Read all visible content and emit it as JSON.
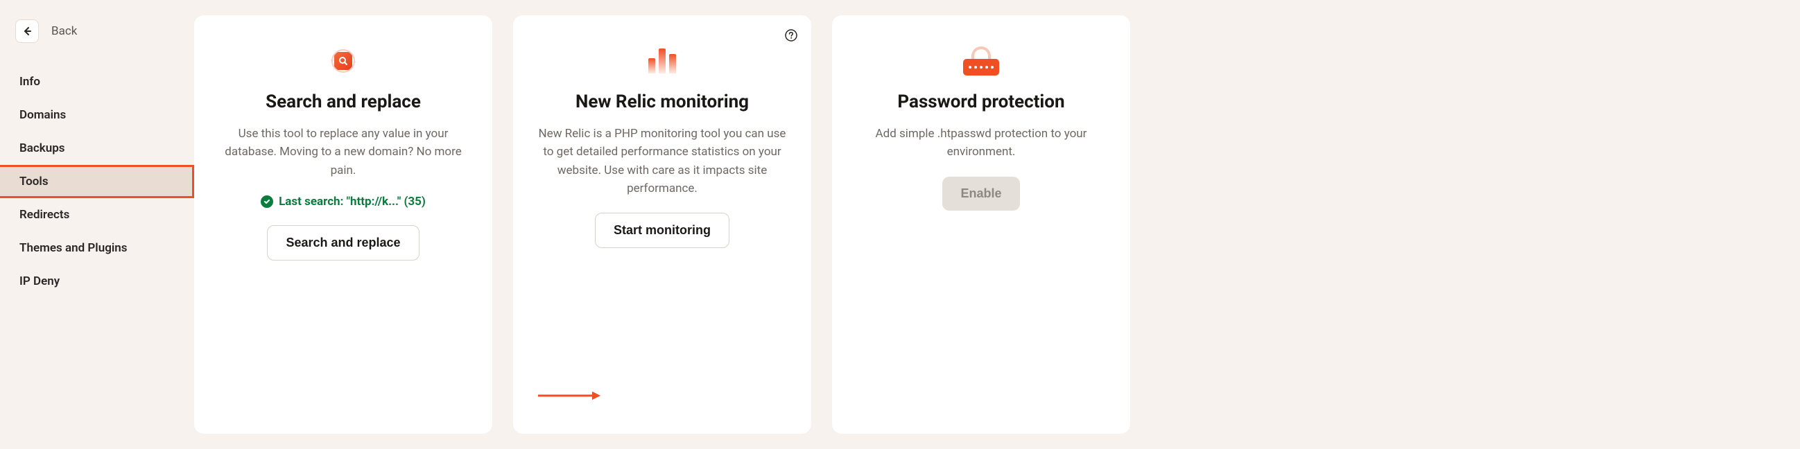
{
  "back": {
    "label": "Back"
  },
  "sidebar": {
    "items": [
      {
        "label": "Info"
      },
      {
        "label": "Domains"
      },
      {
        "label": "Backups"
      },
      {
        "label": "Tools",
        "active": true
      },
      {
        "label": "Redirects"
      },
      {
        "label": "Themes and Plugins"
      },
      {
        "label": "IP Deny"
      }
    ]
  },
  "cards": [
    {
      "title": "Search and replace",
      "description": "Use this tool to replace any value in your database. Moving to a new domain? No more pain.",
      "status": "Last search: \"http://k...\" (35)",
      "button": "Search and replace"
    },
    {
      "title": "New Relic monitoring",
      "description": "New Relic is a PHP monitoring tool you can use to get detailed performance statistics on your website. Use with care as it impacts site performance.",
      "button": "Start monitoring"
    },
    {
      "title": "Password protection",
      "description": "Add simple .htpasswd protection to your environment.",
      "button": "Enable"
    }
  ]
}
